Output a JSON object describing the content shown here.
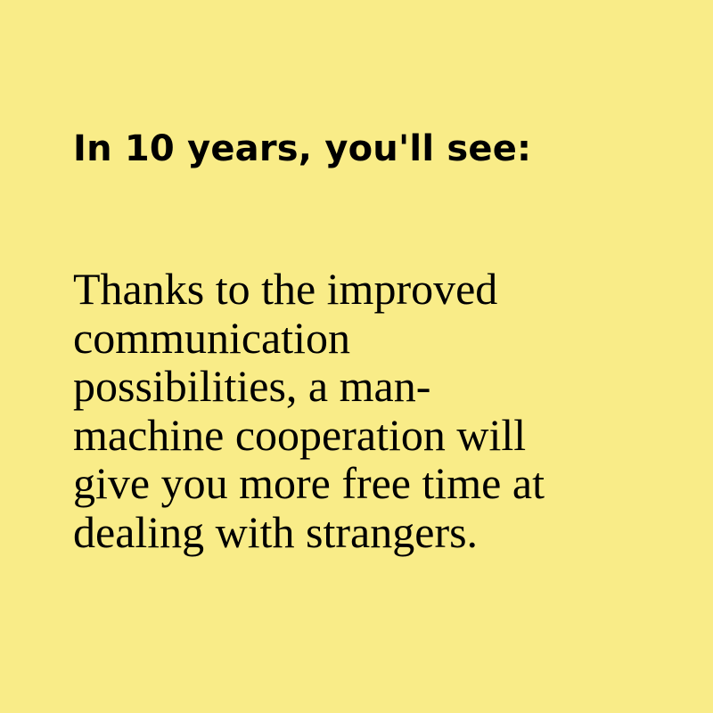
{
  "card": {
    "background_color": "#f9ec88",
    "text_color": "#000000",
    "headline": "In 10 years, you'll see:",
    "body_lines": [
      "Thanks to the improved",
      "communication",
      "possibilities, a man-",
      "machine cooperation will",
      "give you more free time at",
      "dealing with strangers."
    ]
  }
}
